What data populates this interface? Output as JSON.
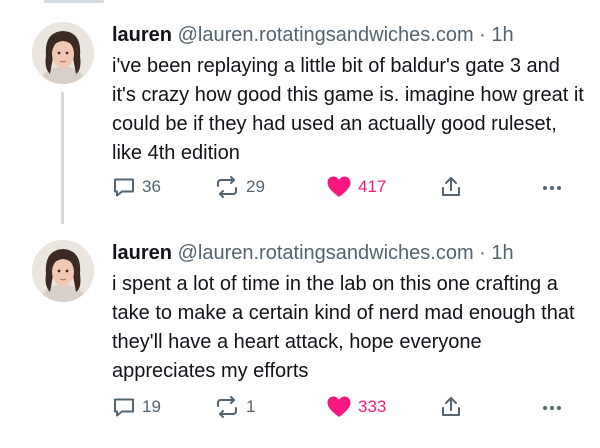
{
  "posts": [
    {
      "name": "lauren",
      "handle": "@lauren.rotatingsandwiches.com",
      "separator": "·",
      "time": "1h",
      "text": "i've been replaying a little bit of baldur's gate 3 and it's crazy how good this game is. imagine how great it could be if they had used an actually good ruleset, like 4th edition",
      "replies": "36",
      "reposts": "29",
      "likes": "417"
    },
    {
      "name": "lauren",
      "handle": "@lauren.rotatingsandwiches.com",
      "separator": "·",
      "time": "1h",
      "text": "i spent a lot of time in the lab on this one crafting a take to make a certain kind of nerd mad enough that they'll have a heart attack, hope everyone appreciates my efforts",
      "replies": "19",
      "reposts": "1",
      "likes": "333"
    }
  ],
  "icons": {
    "reply": "reply-icon",
    "repost": "repost-icon",
    "like": "heart-icon",
    "share": "share-icon",
    "more": "more-icon"
  },
  "colors": {
    "like": "#f91880",
    "action": "#536471",
    "text": "#0f1419",
    "thread_line": "#cfd9de"
  }
}
